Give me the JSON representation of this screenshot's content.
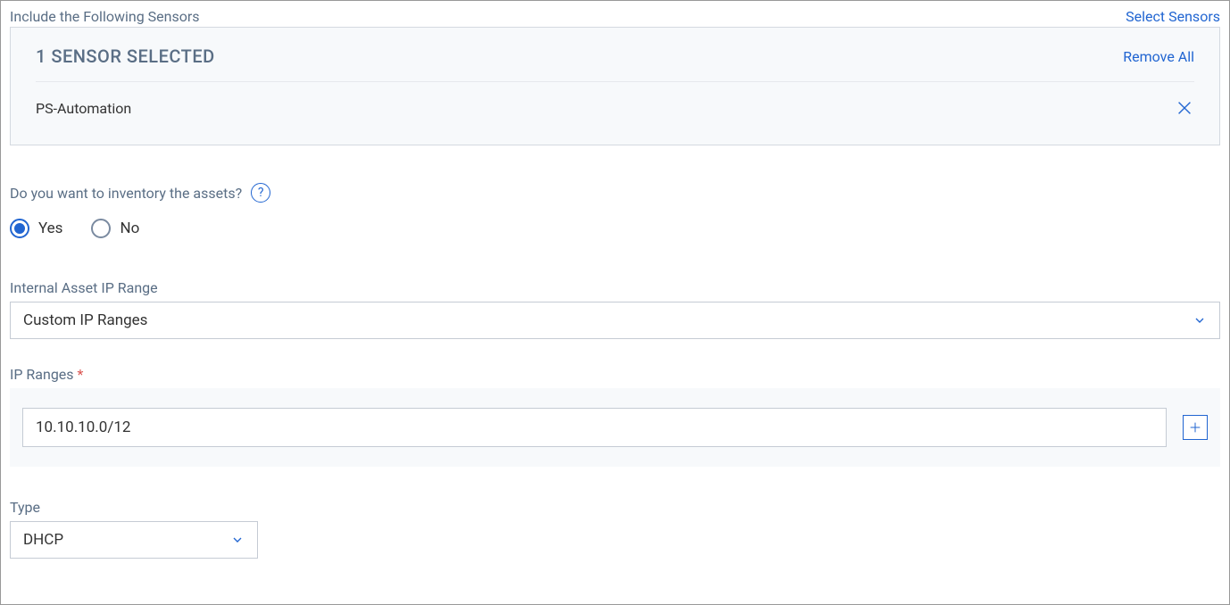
{
  "sensors_section": {
    "title": "Include the Following Sensors",
    "select_link": "Select Sensors",
    "count_label": "1 SENSOR SELECTED",
    "remove_all": "Remove All",
    "items": [
      {
        "name": "PS-Automation"
      }
    ]
  },
  "inventory": {
    "question": "Do you want to inventory the assets?",
    "yes": "Yes",
    "no": "No",
    "selected": "yes"
  },
  "ip_range_section": {
    "label": "Internal Asset IP Range",
    "selected": "Custom IP Ranges"
  },
  "ip_ranges": {
    "label": "IP Ranges",
    "value": "10.10.10.0/12"
  },
  "type_section": {
    "label": "Type",
    "selected": "DHCP"
  }
}
